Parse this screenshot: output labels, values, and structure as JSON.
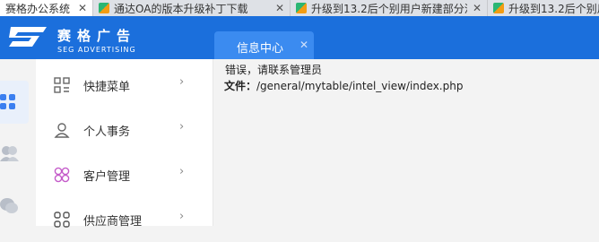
{
  "browser_tabs": [
    {
      "title": "赛格办公系统",
      "close": "✕"
    },
    {
      "title": "通达OA的版本升级补丁下载",
      "close": "✕"
    },
    {
      "title": "升级到13.2后个别用户新建部分流程",
      "close": "✕"
    },
    {
      "title": "升级到13.2后个别用户新建部分流程",
      "close": "✕"
    }
  ],
  "brand": {
    "name_cn": "赛格广告",
    "name_en": "SEG ADVERTISING"
  },
  "app_tab": {
    "label": "信息中心",
    "close": "✕"
  },
  "menu": {
    "items": [
      {
        "label": "快捷菜单",
        "icon": "grid-icon",
        "arrow": "›"
      },
      {
        "label": "个人事务",
        "icon": "person-icon",
        "arrow": "›"
      },
      {
        "label": "客户管理",
        "icon": "clover-icon",
        "arrow": "›"
      },
      {
        "label": "供应商管理",
        "icon": "apps-icon",
        "arrow": "›"
      }
    ]
  },
  "error": {
    "message": "错误，请联系管理员",
    "file_label": "文件：",
    "file_path": "/general/mytable/intel_view/index.php"
  },
  "colors": {
    "header": "#1b6fdc",
    "tab_active": "#3b8bf0"
  }
}
